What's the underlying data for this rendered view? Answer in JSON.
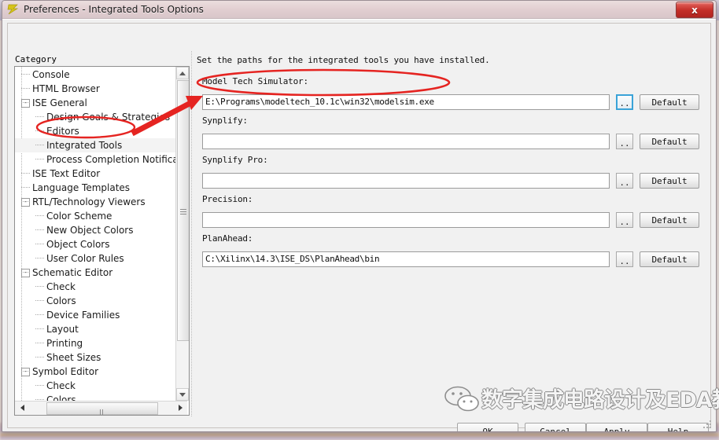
{
  "window": {
    "title": "Preferences - Integrated Tools Options",
    "icon": "lightning-bolt-icon",
    "close_label": "x"
  },
  "category": {
    "label": "Category",
    "tree": [
      {
        "label": "Console",
        "level": 1,
        "expander": "",
        "selected": false
      },
      {
        "label": "HTML Browser",
        "level": 1,
        "expander": "",
        "selected": false
      },
      {
        "label": "ISE General",
        "level": 1,
        "expander": "-",
        "selected": false
      },
      {
        "label": "Design Goals & Strategies",
        "level": 2,
        "expander": "",
        "selected": false
      },
      {
        "label": "Editors",
        "level": 2,
        "expander": "",
        "selected": false
      },
      {
        "label": "Integrated Tools",
        "level": 2,
        "expander": "",
        "selected": true
      },
      {
        "label": "Process Completion Notification",
        "level": 2,
        "expander": "",
        "selected": false
      },
      {
        "label": "ISE Text Editor",
        "level": 1,
        "expander": "",
        "selected": false
      },
      {
        "label": "Language Templates",
        "level": 1,
        "expander": "",
        "selected": false
      },
      {
        "label": "RTL/Technology Viewers",
        "level": 1,
        "expander": "-",
        "selected": false
      },
      {
        "label": "Color Scheme",
        "level": 2,
        "expander": "",
        "selected": false
      },
      {
        "label": "New Object Colors",
        "level": 2,
        "expander": "",
        "selected": false
      },
      {
        "label": "Object Colors",
        "level": 2,
        "expander": "",
        "selected": false
      },
      {
        "label": "User Color Rules",
        "level": 2,
        "expander": "",
        "selected": false
      },
      {
        "label": "Schematic Editor",
        "level": 1,
        "expander": "-",
        "selected": false
      },
      {
        "label": "Check",
        "level": 2,
        "expander": "",
        "selected": false
      },
      {
        "label": "Colors",
        "level": 2,
        "expander": "",
        "selected": false
      },
      {
        "label": "Device Families",
        "level": 2,
        "expander": "",
        "selected": false
      },
      {
        "label": "Layout",
        "level": 2,
        "expander": "",
        "selected": false
      },
      {
        "label": "Printing",
        "level": 2,
        "expander": "",
        "selected": false
      },
      {
        "label": "Sheet Sizes",
        "level": 2,
        "expander": "",
        "selected": false
      },
      {
        "label": "Symbol Editor",
        "level": 1,
        "expander": "-",
        "selected": false
      },
      {
        "label": "Check",
        "level": 2,
        "expander": "",
        "selected": false
      },
      {
        "label": "Colors",
        "level": 2,
        "expander": "",
        "selected": false
      }
    ]
  },
  "main": {
    "description": "Set the paths for the integrated tools you have installed.",
    "fields": [
      {
        "label": "Model Tech Simulator:",
        "value": "E:\\Programs\\modeltech_10.1c\\win32\\modelsim.exe",
        "browse_label": "..",
        "default_label": "Default",
        "browse_focused": true
      },
      {
        "label": "Synplify:",
        "value": "",
        "browse_label": "..",
        "default_label": "Default",
        "browse_focused": false
      },
      {
        "label": "Synplify Pro:",
        "value": "",
        "browse_label": "..",
        "default_label": "Default",
        "browse_focused": false
      },
      {
        "label": "Precision:",
        "value": "",
        "browse_label": "..",
        "default_label": "Default",
        "browse_focused": false
      },
      {
        "label": "PlanAhead:",
        "value": "C:\\Xilinx\\14.3\\ISE_DS\\PlanAhead\\bin",
        "browse_label": "..",
        "default_label": "Default",
        "browse_focused": false
      }
    ]
  },
  "buttons": {
    "ok": "OK",
    "cancel": "Cancel",
    "apply": "Apply",
    "help": "Help"
  },
  "watermark": {
    "text": "数字集成电路设计及EDA教程",
    "logo": "wechat-icon"
  },
  "colors": {
    "annotation": "#e52421",
    "accent": "#3aa3d8",
    "close": "#c32d27",
    "dialog_bg": "#f0f0f0"
  }
}
